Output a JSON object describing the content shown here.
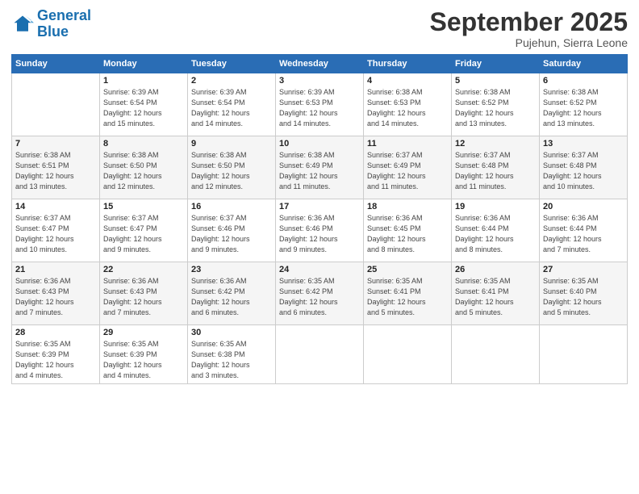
{
  "header": {
    "logo_line1": "General",
    "logo_line2": "Blue",
    "month": "September 2025",
    "location": "Pujehun, Sierra Leone"
  },
  "days_of_week": [
    "Sunday",
    "Monday",
    "Tuesday",
    "Wednesday",
    "Thursday",
    "Friday",
    "Saturday"
  ],
  "weeks": [
    [
      {
        "day": "",
        "info": ""
      },
      {
        "day": "1",
        "info": "Sunrise: 6:39 AM\nSunset: 6:54 PM\nDaylight: 12 hours\nand 15 minutes."
      },
      {
        "day": "2",
        "info": "Sunrise: 6:39 AM\nSunset: 6:54 PM\nDaylight: 12 hours\nand 14 minutes."
      },
      {
        "day": "3",
        "info": "Sunrise: 6:39 AM\nSunset: 6:53 PM\nDaylight: 12 hours\nand 14 minutes."
      },
      {
        "day": "4",
        "info": "Sunrise: 6:38 AM\nSunset: 6:53 PM\nDaylight: 12 hours\nand 14 minutes."
      },
      {
        "day": "5",
        "info": "Sunrise: 6:38 AM\nSunset: 6:52 PM\nDaylight: 12 hours\nand 13 minutes."
      },
      {
        "day": "6",
        "info": "Sunrise: 6:38 AM\nSunset: 6:52 PM\nDaylight: 12 hours\nand 13 minutes."
      }
    ],
    [
      {
        "day": "7",
        "info": "Sunrise: 6:38 AM\nSunset: 6:51 PM\nDaylight: 12 hours\nand 13 minutes."
      },
      {
        "day": "8",
        "info": "Sunrise: 6:38 AM\nSunset: 6:50 PM\nDaylight: 12 hours\nand 12 minutes."
      },
      {
        "day": "9",
        "info": "Sunrise: 6:38 AM\nSunset: 6:50 PM\nDaylight: 12 hours\nand 12 minutes."
      },
      {
        "day": "10",
        "info": "Sunrise: 6:38 AM\nSunset: 6:49 PM\nDaylight: 12 hours\nand 11 minutes."
      },
      {
        "day": "11",
        "info": "Sunrise: 6:37 AM\nSunset: 6:49 PM\nDaylight: 12 hours\nand 11 minutes."
      },
      {
        "day": "12",
        "info": "Sunrise: 6:37 AM\nSunset: 6:48 PM\nDaylight: 12 hours\nand 11 minutes."
      },
      {
        "day": "13",
        "info": "Sunrise: 6:37 AM\nSunset: 6:48 PM\nDaylight: 12 hours\nand 10 minutes."
      }
    ],
    [
      {
        "day": "14",
        "info": "Sunrise: 6:37 AM\nSunset: 6:47 PM\nDaylight: 12 hours\nand 10 minutes."
      },
      {
        "day": "15",
        "info": "Sunrise: 6:37 AM\nSunset: 6:47 PM\nDaylight: 12 hours\nand 9 minutes."
      },
      {
        "day": "16",
        "info": "Sunrise: 6:37 AM\nSunset: 6:46 PM\nDaylight: 12 hours\nand 9 minutes."
      },
      {
        "day": "17",
        "info": "Sunrise: 6:36 AM\nSunset: 6:46 PM\nDaylight: 12 hours\nand 9 minutes."
      },
      {
        "day": "18",
        "info": "Sunrise: 6:36 AM\nSunset: 6:45 PM\nDaylight: 12 hours\nand 8 minutes."
      },
      {
        "day": "19",
        "info": "Sunrise: 6:36 AM\nSunset: 6:44 PM\nDaylight: 12 hours\nand 8 minutes."
      },
      {
        "day": "20",
        "info": "Sunrise: 6:36 AM\nSunset: 6:44 PM\nDaylight: 12 hours\nand 7 minutes."
      }
    ],
    [
      {
        "day": "21",
        "info": "Sunrise: 6:36 AM\nSunset: 6:43 PM\nDaylight: 12 hours\nand 7 minutes."
      },
      {
        "day": "22",
        "info": "Sunrise: 6:36 AM\nSunset: 6:43 PM\nDaylight: 12 hours\nand 7 minutes."
      },
      {
        "day": "23",
        "info": "Sunrise: 6:36 AM\nSunset: 6:42 PM\nDaylight: 12 hours\nand 6 minutes."
      },
      {
        "day": "24",
        "info": "Sunrise: 6:35 AM\nSunset: 6:42 PM\nDaylight: 12 hours\nand 6 minutes."
      },
      {
        "day": "25",
        "info": "Sunrise: 6:35 AM\nSunset: 6:41 PM\nDaylight: 12 hours\nand 5 minutes."
      },
      {
        "day": "26",
        "info": "Sunrise: 6:35 AM\nSunset: 6:41 PM\nDaylight: 12 hours\nand 5 minutes."
      },
      {
        "day": "27",
        "info": "Sunrise: 6:35 AM\nSunset: 6:40 PM\nDaylight: 12 hours\nand 5 minutes."
      }
    ],
    [
      {
        "day": "28",
        "info": "Sunrise: 6:35 AM\nSunset: 6:39 PM\nDaylight: 12 hours\nand 4 minutes."
      },
      {
        "day": "29",
        "info": "Sunrise: 6:35 AM\nSunset: 6:39 PM\nDaylight: 12 hours\nand 4 minutes."
      },
      {
        "day": "30",
        "info": "Sunrise: 6:35 AM\nSunset: 6:38 PM\nDaylight: 12 hours\nand 3 minutes."
      },
      {
        "day": "",
        "info": ""
      },
      {
        "day": "",
        "info": ""
      },
      {
        "day": "",
        "info": ""
      },
      {
        "day": "",
        "info": ""
      }
    ]
  ]
}
